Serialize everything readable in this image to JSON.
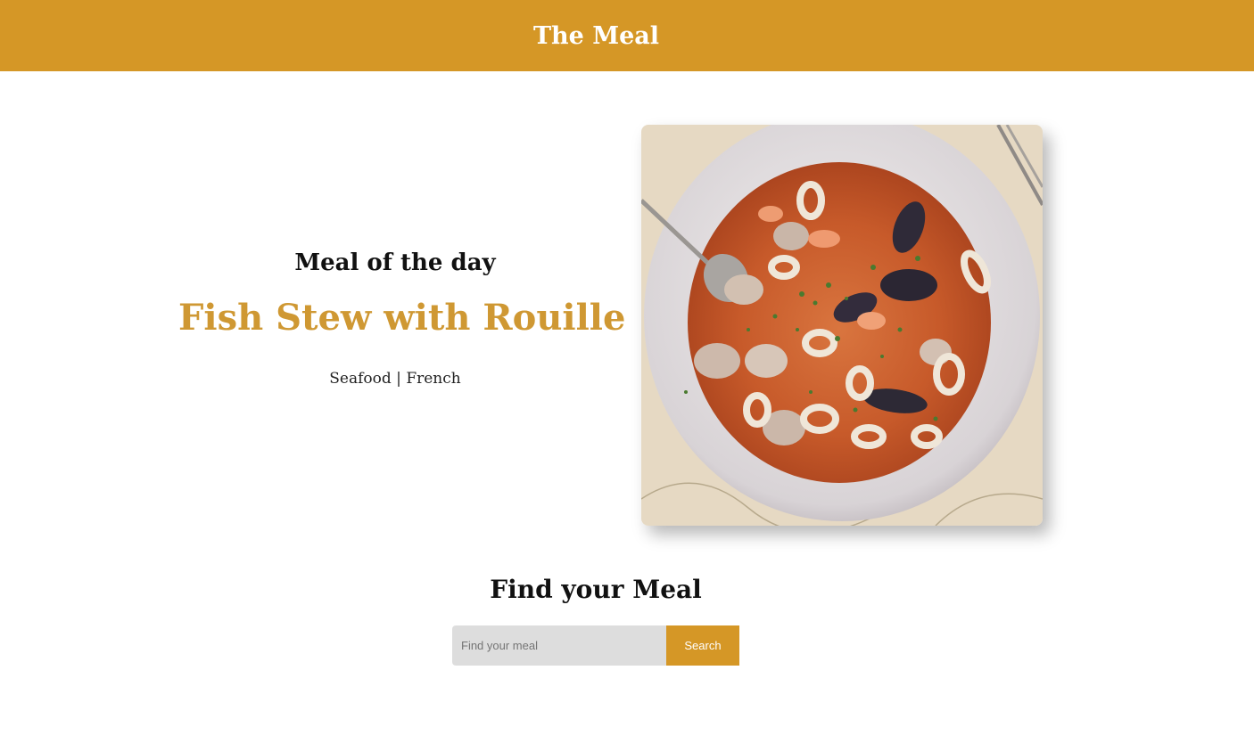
{
  "header": {
    "title": "The Meal",
    "background_color": "#d59726"
  },
  "meal_of_the_day": {
    "heading": "Meal of the day",
    "name": "Fish Stew with Rouille",
    "category": "Seafood",
    "separator": "|",
    "area": "French",
    "name_color": "#cf9833",
    "image_description_icon": "fish-stew-photo"
  },
  "search": {
    "heading": "Find your Meal",
    "placeholder": "Find your meal",
    "value": "",
    "button_label": "Search",
    "button_color": "#d59726"
  }
}
